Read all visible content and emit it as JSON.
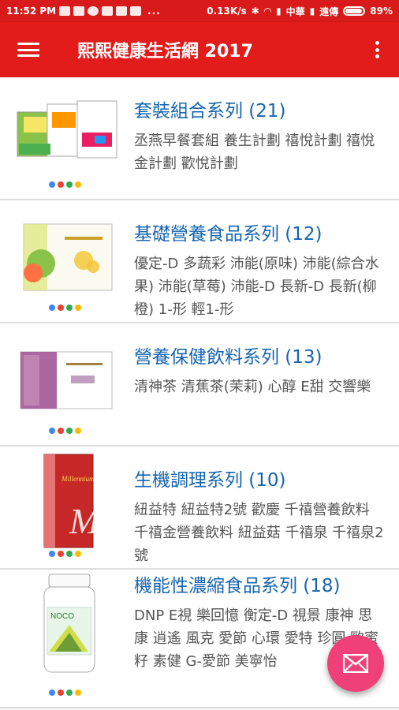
{
  "status_bar": {
    "time": "11:52 PM",
    "overflow": "...",
    "speed": "0.13K/s",
    "carrier1": "中華",
    "carrier2": "遠傳",
    "battery": "89%"
  },
  "app_bar": {
    "title": "熙熙健康生活網 2017",
    "menu_icon": "menu-icon",
    "overflow_icon": "more-vert-icon"
  },
  "categories": [
    {
      "title": "套裝組合系列 (21)",
      "description": "丞燕早餐套組 養生計劃 禧悅計劃 禧悅金計劃 歡悅計劃"
    },
    {
      "title": "基礎營養食品系列 (12)",
      "description": "優定-D 多蔬彩 沛能(原味) 沛能(綜合水果) 沛能(草莓) 沛能-D 長新-D 長新(柳橙) 1-形 輕1-形"
    },
    {
      "title": "營養保健飲料系列 (13)",
      "description": "清神茶 清蕉茶(茉莉) 心醇 E甜 交響樂"
    },
    {
      "title": "生機調理系列 (10)",
      "description": "紐益特 紐益特2號 歡慶 千禧營養飲料 千禧金營養飲料 紐益菇 千禧泉 千禧泉2號"
    },
    {
      "title": "機能性濃縮食品系列 (18)",
      "description": "DNP E視 樂回憶 衡定-D 視景 康神 思康 逍遙 風克 愛節 心環 愛特 珍圓 歐蜜籽 素健 G-愛節 美寧怡"
    }
  ],
  "dot_colors": [
    "#4285f4",
    "#ea4335",
    "#34a853",
    "#fbbc05"
  ],
  "colors": {
    "primary": "#e21b1b",
    "title_text": "#1565b0",
    "fab": "#f0407a"
  },
  "fab": {
    "icon": "mail-icon"
  }
}
